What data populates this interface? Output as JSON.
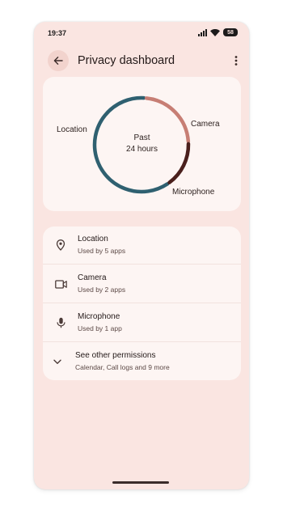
{
  "status_bar": {
    "time": "19:37",
    "battery": "58"
  },
  "header": {
    "title": "Privacy dashboard",
    "back_icon": "arrow-back-icon",
    "more_icon": "more-vert-icon"
  },
  "chart_data": {
    "type": "pie",
    "title": "",
    "center_label_line1": "Past",
    "center_label_line2": "24 hours",
    "categories": [
      "Location",
      "Camera",
      "Microphone"
    ],
    "values": [
      61,
      23,
      16
    ],
    "colors": [
      "#2f6070",
      "#c77e74",
      "#4a1f1c"
    ],
    "legend": "labels beside segments"
  },
  "permissions": [
    {
      "icon": "location-pin-icon",
      "title": "Location",
      "subtitle": "Used by 5 apps"
    },
    {
      "icon": "videocam-icon",
      "title": "Camera",
      "subtitle": "Used by 2 apps"
    },
    {
      "icon": "mic-icon",
      "title": "Microphone",
      "subtitle": "Used by 1 app"
    },
    {
      "icon": "chevron-down-icon",
      "title": "See other permissions",
      "subtitle": "Calendar, Call logs and 9 more"
    }
  ],
  "colors": {
    "background": "#fae5e1",
    "card": "#fdf5f3",
    "accent": "#2f6070"
  }
}
